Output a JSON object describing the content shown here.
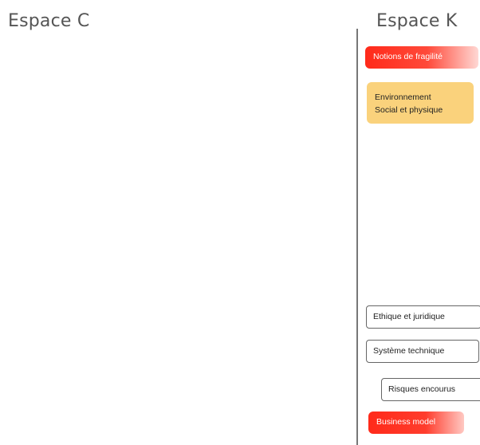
{
  "spaces": {
    "left_title": "Espace C",
    "right_title": "Espace K"
  },
  "concepts": {
    "fragility": "Notions de fragilité",
    "environment_line1": "Environnement",
    "environment_line2": "Social et physique",
    "ethics": "Ethique et juridique",
    "system": "Système technique",
    "risks": "Risques encourus",
    "business": "Business model"
  },
  "colors": {
    "red_card": "#ff2a1a",
    "orange_card": "#fad27c",
    "outline": "#666666",
    "divider": "#777777"
  }
}
